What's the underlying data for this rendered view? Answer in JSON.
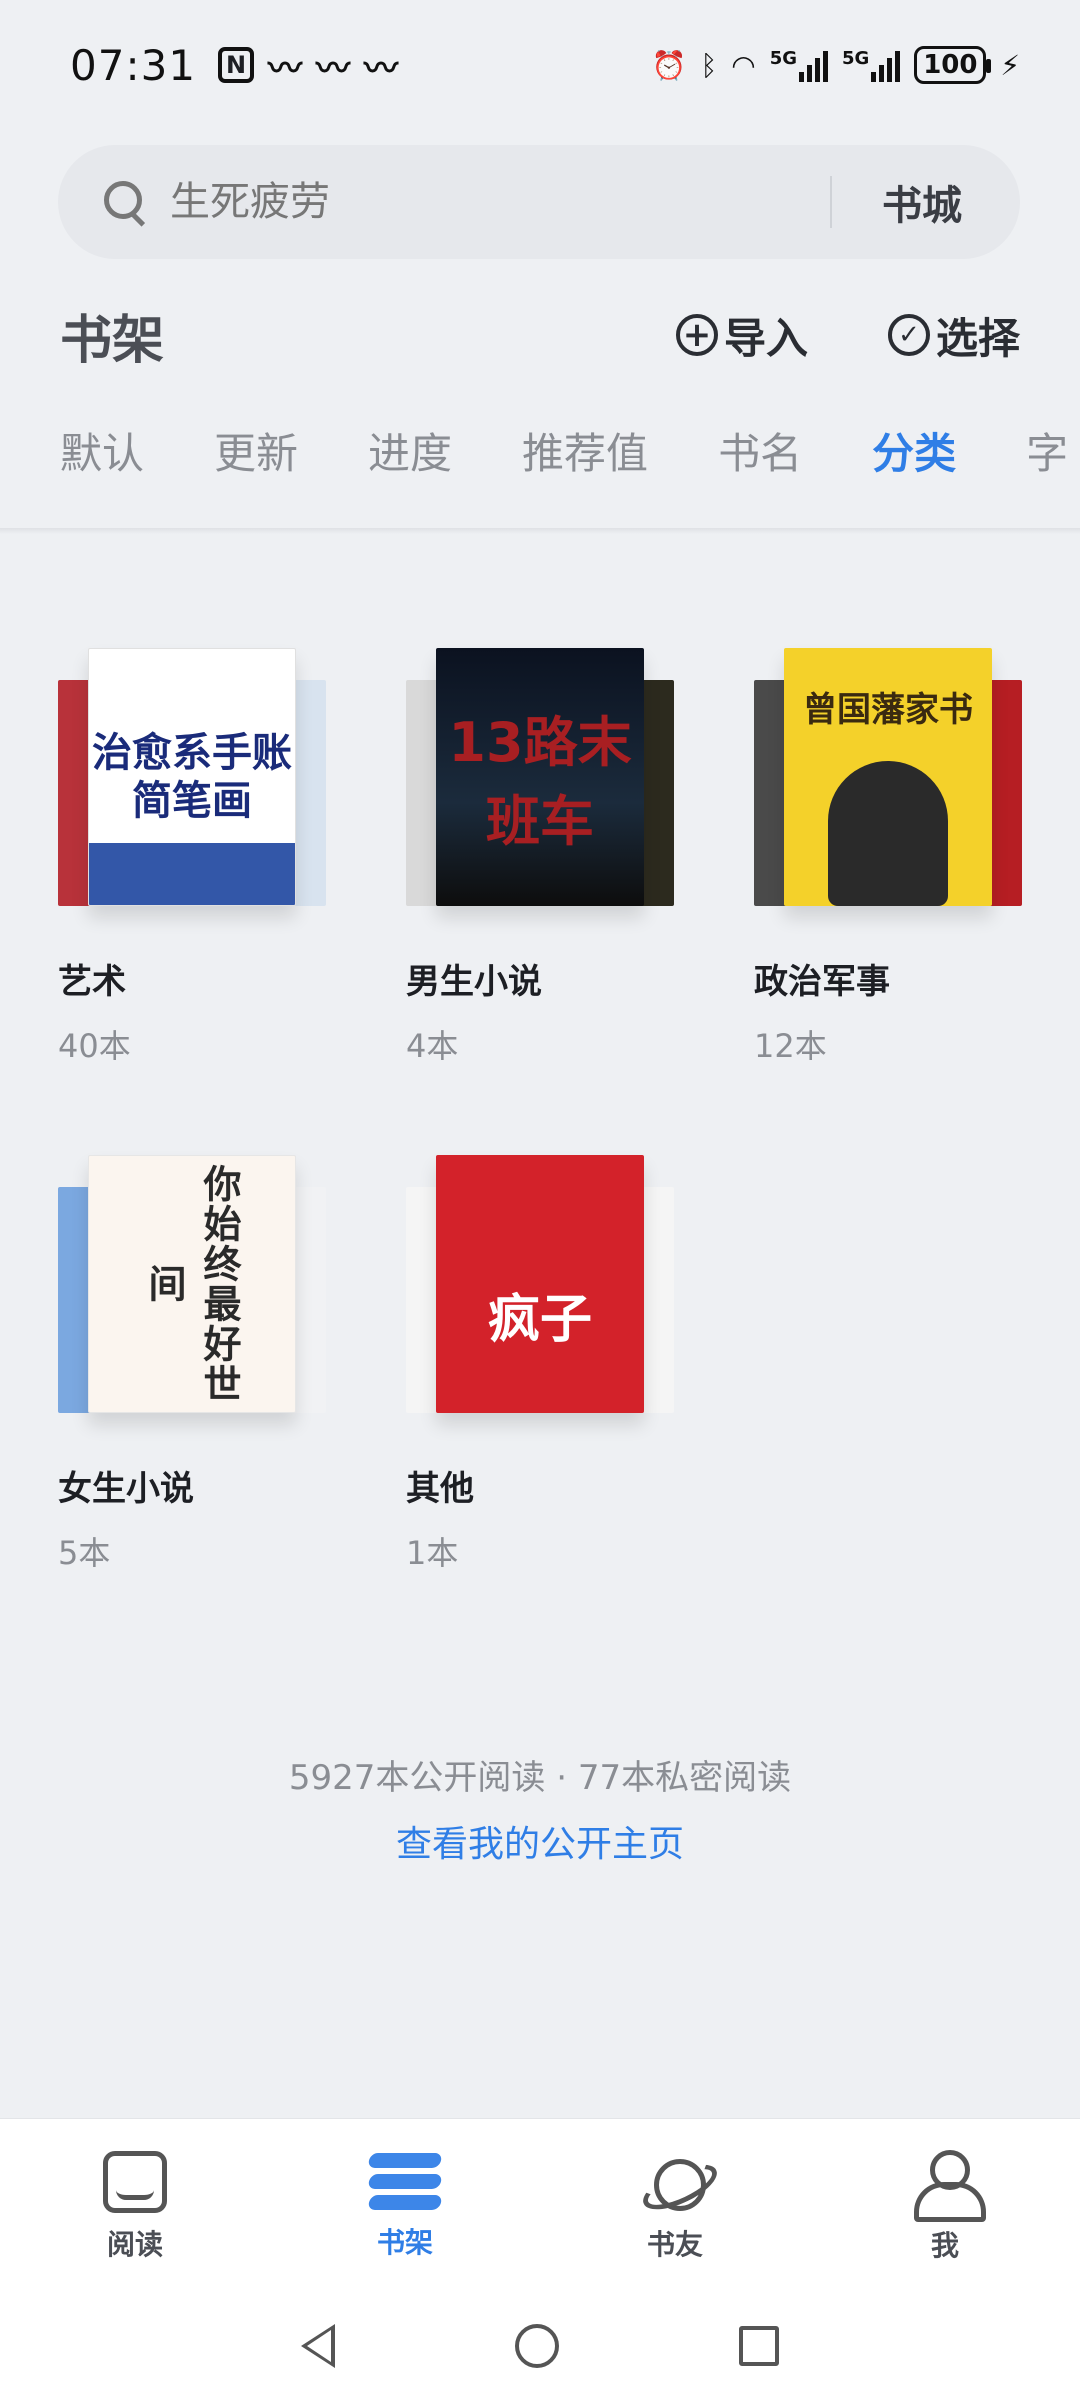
{
  "status": {
    "time": "07:31",
    "battery": "100",
    "net1": "5G",
    "net2": "5G"
  },
  "search": {
    "placeholder": "生死疲劳",
    "bookstore_label": "书城"
  },
  "header": {
    "title": "书架",
    "import_label": "导入",
    "select_label": "选择"
  },
  "sort_tabs": [
    {
      "label": "默认"
    },
    {
      "label": "更新"
    },
    {
      "label": "进度"
    },
    {
      "label": "推荐值"
    },
    {
      "label": "书名"
    },
    {
      "label": "分类",
      "active": true
    },
    {
      "label": "字"
    }
  ],
  "categories": [
    {
      "name": "艺术",
      "count": "40本",
      "cover_text": "治愈系手账简笔画"
    },
    {
      "name": "男生小说",
      "count": "4本",
      "cover_text": "13路末班车"
    },
    {
      "name": "政治军事",
      "count": "12本",
      "cover_text": "曾国藩家书"
    },
    {
      "name": "女生小说",
      "count": "5本",
      "cover_text": "你始终最好世间"
    },
    {
      "name": "其他",
      "count": "1本",
      "cover_text": "疯子"
    }
  ],
  "footer": {
    "stats": "5927本公开阅读 · 77本私密阅读",
    "homepage_link": "查看我的公开主页"
  },
  "bottom_nav": [
    {
      "label": "阅读",
      "icon": "book-icon"
    },
    {
      "label": "书架",
      "icon": "bookshelf-icon",
      "active": true
    },
    {
      "label": "书友",
      "icon": "planet-icon"
    },
    {
      "label": "我",
      "icon": "person-icon"
    }
  ],
  "colors": {
    "accent": "#2f7ee6",
    "background": "#eef0f3"
  }
}
